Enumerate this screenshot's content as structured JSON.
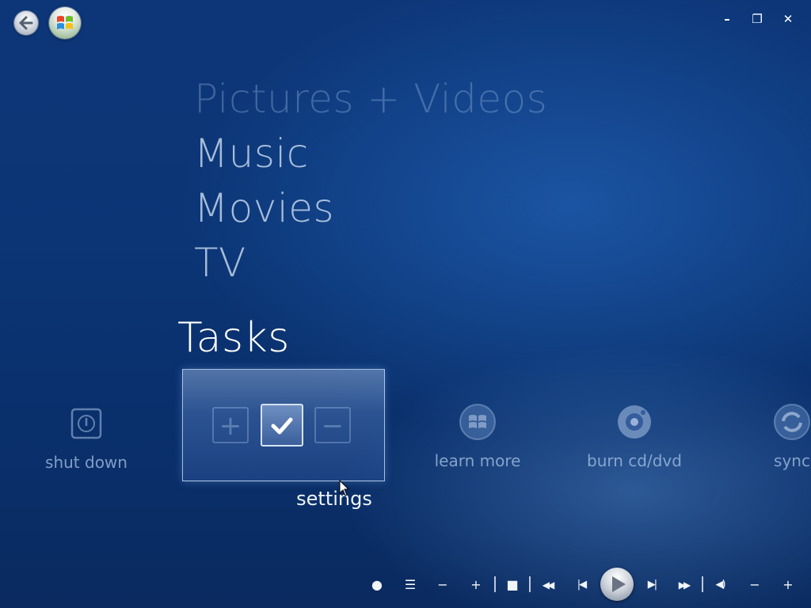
{
  "window": {
    "minimize_label": "–",
    "restore_label": "❐",
    "close_label": "✕"
  },
  "menu": {
    "items": [
      {
        "label": "Pictures + Videos"
      },
      {
        "label": "Music"
      },
      {
        "label": "Movies"
      },
      {
        "label": "TV"
      },
      {
        "label": "Tasks"
      }
    ]
  },
  "tasks": {
    "items": [
      {
        "label": "shut down",
        "icon": "power-icon"
      },
      {
        "label": "settings",
        "icon": "checkbox-icon"
      },
      {
        "label": "learn more",
        "icon": "windows-logo-icon"
      },
      {
        "label": "burn cd/dvd",
        "icon": "disc-icon"
      },
      {
        "label": "sync",
        "icon": "sync-icon"
      }
    ],
    "settings_plus": "+",
    "settings_minus": "−"
  },
  "transport": {
    "record": "●",
    "guide": "☰",
    "channel_down": "−",
    "channel_up": "+",
    "stop": "■",
    "rewind": "◀◀",
    "previous": "|◀",
    "next": "▶|",
    "fast_forward": "▶▶",
    "mute": "◀)",
    "volume_down": "−",
    "volume_up": "+"
  },
  "colors": {
    "background": "#0b3575",
    "text_primary": "#ffffff",
    "text_dim": "#aac3e6"
  }
}
